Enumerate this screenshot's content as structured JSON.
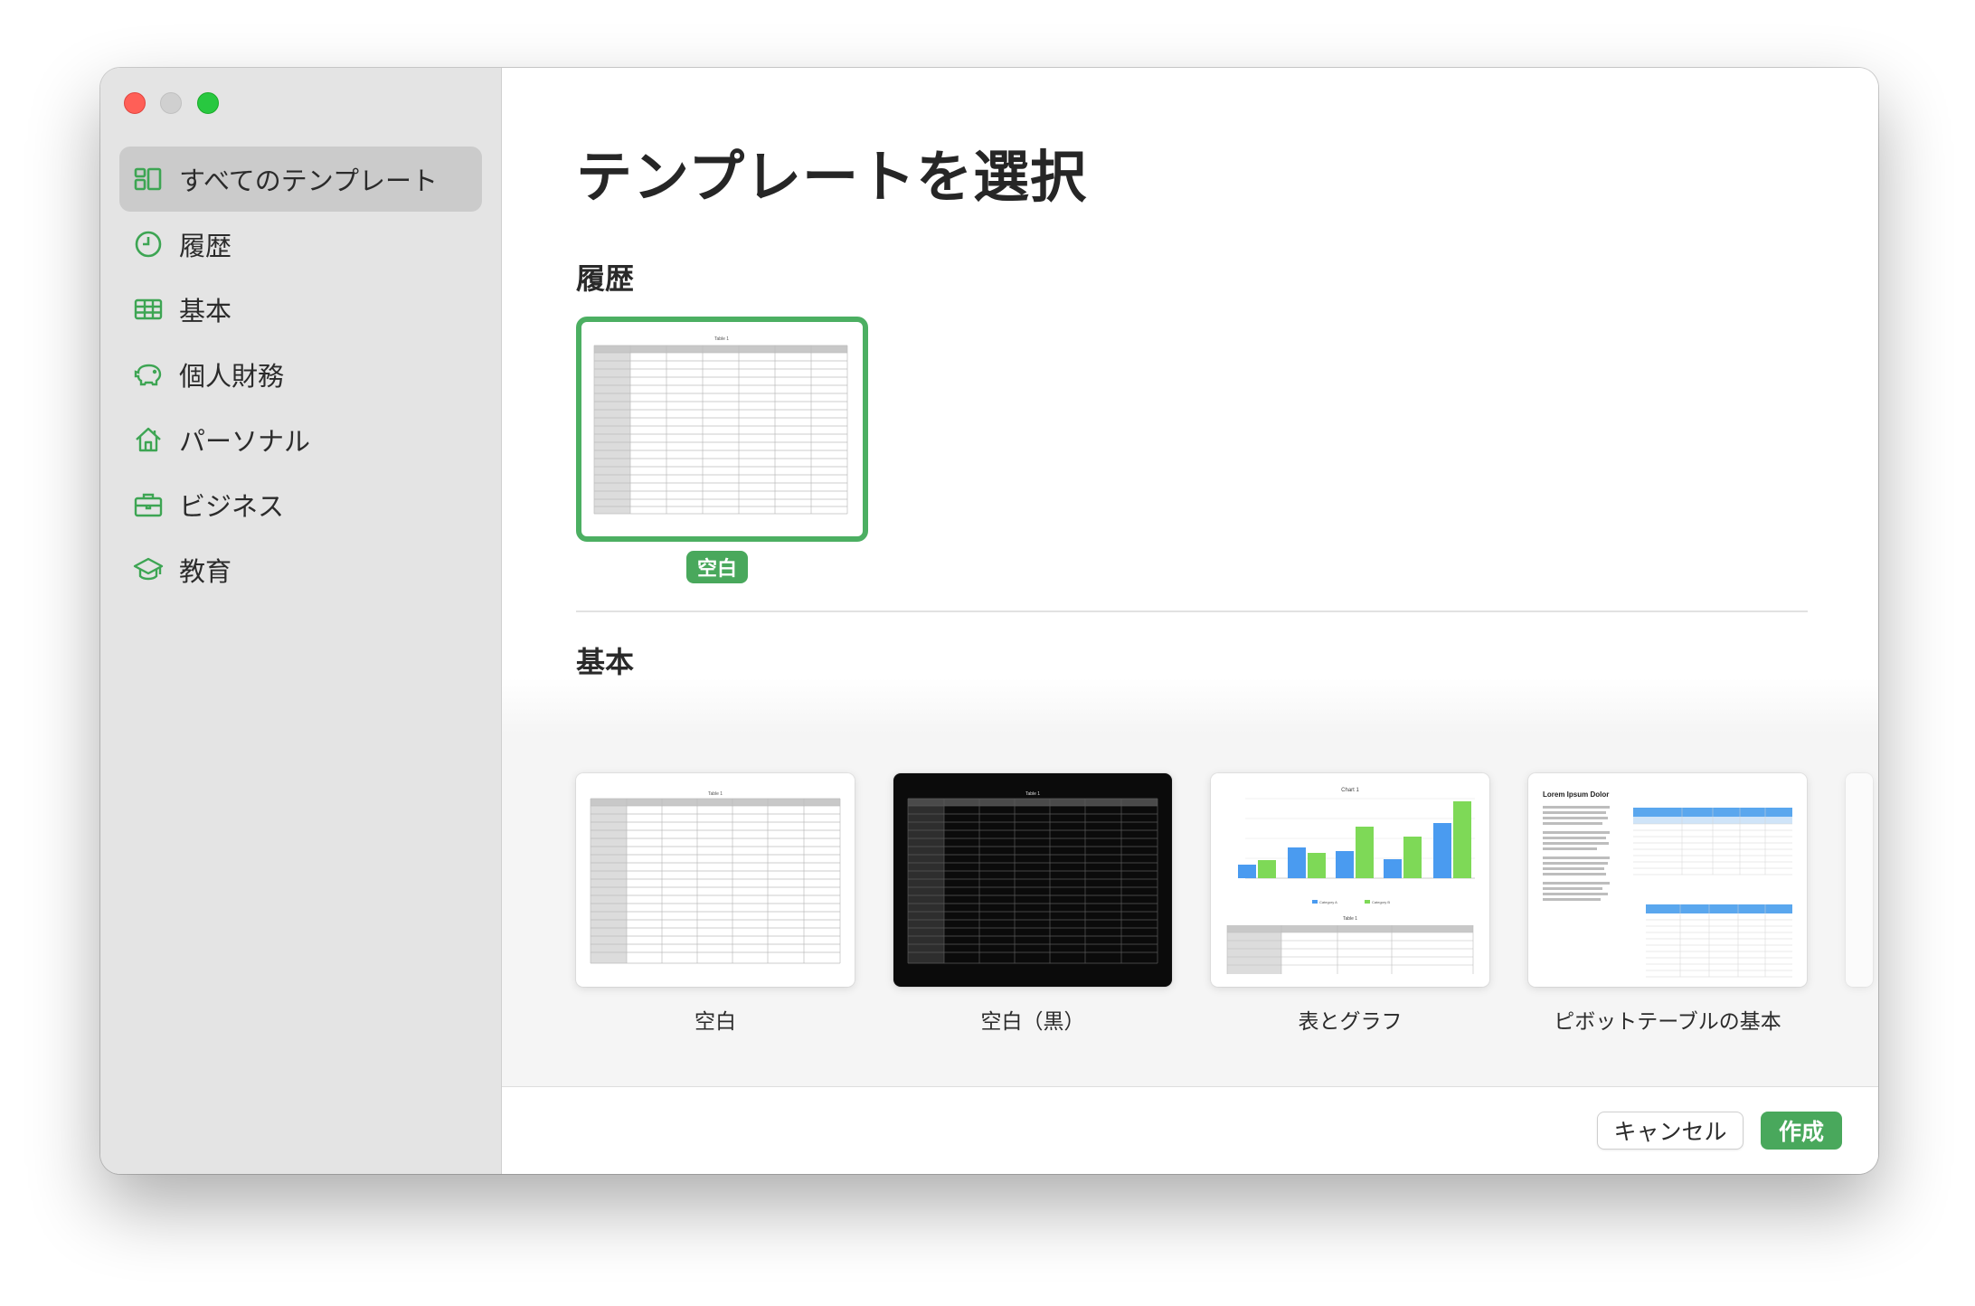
{
  "window": {
    "controls": [
      "close",
      "minimize",
      "zoom"
    ]
  },
  "sidebar": {
    "items": [
      {
        "label": "すべてのテンプレート",
        "icon": "all-templates-icon",
        "active": true
      },
      {
        "label": "履歴",
        "icon": "clock-icon"
      },
      {
        "label": "基本",
        "icon": "table-icon"
      },
      {
        "label": "個人財務",
        "icon": "piggy-bank-icon"
      },
      {
        "label": "パーソナル",
        "icon": "house-icon"
      },
      {
        "label": "ビジネス",
        "icon": "briefcase-icon"
      },
      {
        "label": "教育",
        "icon": "graduation-cap-icon"
      }
    ]
  },
  "main": {
    "title": "テンプレートを選択",
    "recent": {
      "heading": "履歴",
      "items": [
        {
          "label": "空白",
          "selected": true
        }
      ]
    },
    "basic": {
      "heading": "基本",
      "items": [
        {
          "label": "空白",
          "thumb_title": "Table 1"
        },
        {
          "label": "空白（黒）",
          "thumb_title": "Table 1"
        },
        {
          "label": "表とグラフ",
          "thumb_title": "Chart 1",
          "thumb_legend": [
            "Category A",
            "Category B"
          ],
          "thumb_table_title": "Table 1"
        },
        {
          "label": "ピボットテーブルの基本",
          "thumb_title": "Lorem Ipsum Dolor"
        }
      ]
    }
  },
  "footer": {
    "cancel_label": "キャンセル",
    "create_label": "作成"
  },
  "colors": {
    "accent": "#49a85c",
    "sidebar_bg": "#e4e4e4",
    "chart_blue": "#4a9bf0",
    "chart_green": "#7ed957"
  }
}
